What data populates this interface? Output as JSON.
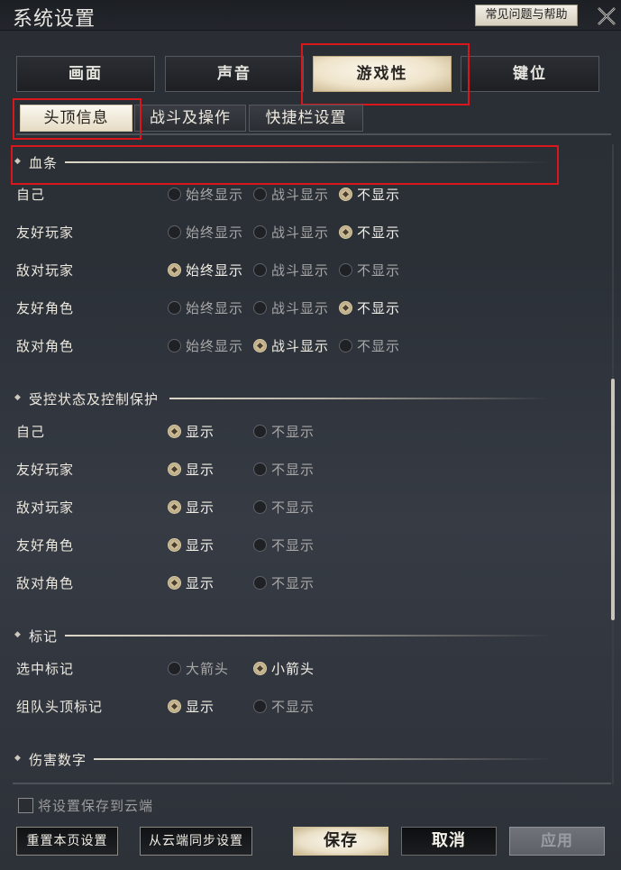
{
  "window": {
    "title": "系统设置",
    "help_label": "常见问题与帮助"
  },
  "tabs": [
    {
      "label": "画面"
    },
    {
      "label": "声音"
    },
    {
      "label": "游戏性"
    },
    {
      "label": "键位"
    }
  ],
  "subtabs": [
    {
      "label": "头顶信息"
    },
    {
      "label": "战斗及操作"
    },
    {
      "label": "快捷栏设置"
    }
  ],
  "sections": {
    "health_bar": {
      "title": "血条",
      "rows": [
        {
          "label": "自己",
          "options": [
            "始终显示",
            "战斗显示",
            "不显示"
          ],
          "selected": 2
        },
        {
          "label": "友好玩家",
          "options": [
            "始终显示",
            "战斗显示",
            "不显示"
          ],
          "selected": 2
        },
        {
          "label": "敌对玩家",
          "options": [
            "始终显示",
            "战斗显示",
            "不显示"
          ],
          "selected": 0
        },
        {
          "label": "友好角色",
          "options": [
            "始终显示",
            "战斗显示",
            "不显示"
          ],
          "selected": 2
        },
        {
          "label": "敌对角色",
          "options": [
            "始终显示",
            "战斗显示",
            "不显示"
          ],
          "selected": 1
        }
      ]
    },
    "control_state": {
      "title": "受控状态及控制保护",
      "rows": [
        {
          "label": "自己",
          "options": [
            "显示",
            "不显示"
          ],
          "selected": 0
        },
        {
          "label": "友好玩家",
          "options": [
            "显示",
            "不显示"
          ],
          "selected": 0
        },
        {
          "label": "敌对玩家",
          "options": [
            "显示",
            "不显示"
          ],
          "selected": 0
        },
        {
          "label": "友好角色",
          "options": [
            "显示",
            "不显示"
          ],
          "selected": 0
        },
        {
          "label": "敌对角色",
          "options": [
            "显示",
            "不显示"
          ],
          "selected": 0
        }
      ]
    },
    "marker": {
      "title": "标记",
      "rows": [
        {
          "label": "选中标记",
          "options": [
            "大箭头",
            "小箭头"
          ],
          "selected": 1
        },
        {
          "label": "组队头顶标记",
          "options": [
            "显示",
            "不显示"
          ],
          "selected": 0
        }
      ]
    },
    "damage_numbers": {
      "title": "伤害数字"
    }
  },
  "footer": {
    "cloud_save_label": "将设置保存到云端",
    "cloud_save_checked": false,
    "reset_label": "重置本页设置",
    "sync_label": "从云端同步设置",
    "save_label": "保存",
    "cancel_label": "取消",
    "apply_label": "应用"
  }
}
